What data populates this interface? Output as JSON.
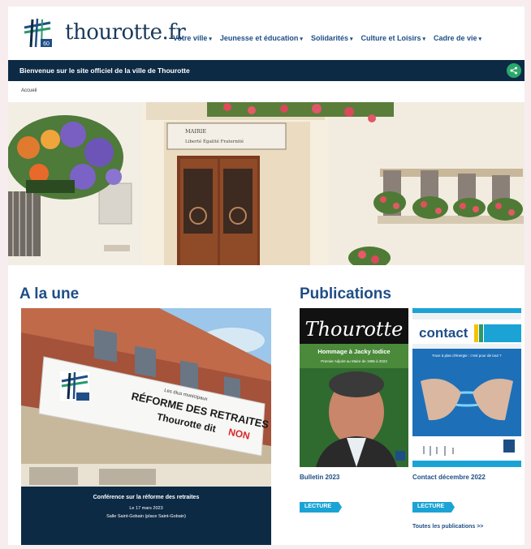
{
  "site": {
    "logo_text": "thourotte.fr",
    "logo_badge": "60"
  },
  "nav": {
    "items": [
      {
        "label": "Votre ville"
      },
      {
        "label": "Jeunesse et éducation"
      },
      {
        "label": "Solidarités"
      },
      {
        "label": "Culture et Loisirs"
      },
      {
        "label": "Cadre de vie"
      }
    ],
    "caret": "▾"
  },
  "banner": {
    "text": "Bienvenue sur le site officiel de la ville de Thourotte",
    "share_icon": "share-icon"
  },
  "breadcrumb": "Accueil",
  "hero": {
    "sign_line1": "MAIRIE",
    "sign_line2": "Liberté   Égalité   Fraternité"
  },
  "a_la_une": {
    "title": "A la une",
    "banner_small": "Les élus municipaux",
    "banner_line1": "RÉFORME DES RETRAITES",
    "banner_line2a": "Thourotte dit",
    "banner_line2b": "NON",
    "caption_title": "Conférence sur la réforme des retraites",
    "caption_date": "Le 17 mars 2023",
    "caption_place": "Salle Saint-Gobain (place Saint-Gobain)"
  },
  "publications": {
    "title": "Publications",
    "items": [
      {
        "cover_title": "Thourotte",
        "cover_headline": "Hommage à Jacky Iodice",
        "cover_sub": "Premier Adjoint au Maire de 1995 à 2022",
        "title": "Bulletin 2023",
        "button": "LECTURE"
      },
      {
        "cover_title": "contact",
        "cover_sub": "Face à plan d'énergie : c'est pour de tout ?",
        "title": "Contact décembre 2022",
        "button": "LECTURE"
      }
    ],
    "all_link": "Toutes les publications >>"
  },
  "colors": {
    "navy": "#0d2a45",
    "link_blue": "#1f4e86",
    "accent_cyan": "#1ba3d6",
    "share_green": "#2aa86b"
  }
}
